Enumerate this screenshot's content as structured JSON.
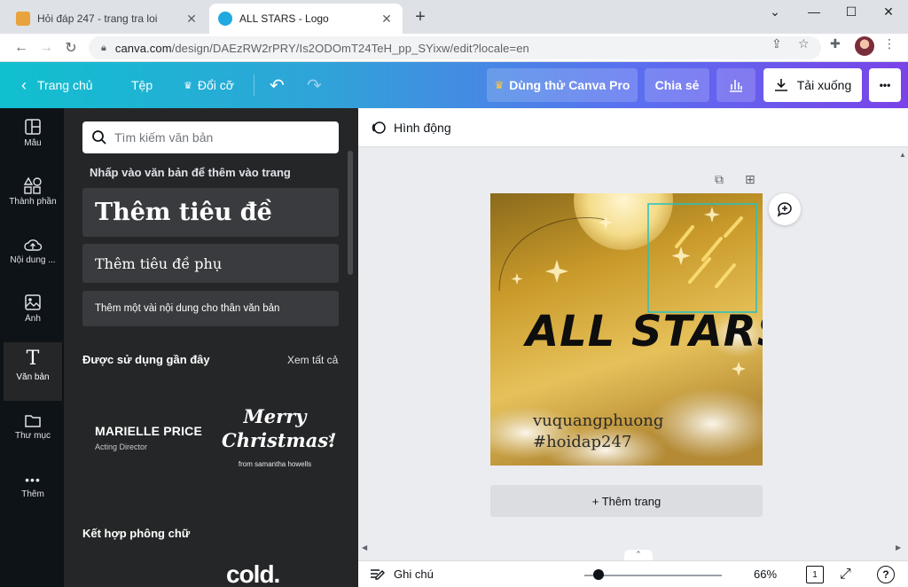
{
  "browser": {
    "tabs": [
      {
        "title": "Hỏi đáp 247 - trang tra loi",
        "favicon_color": "#e8a33c"
      },
      {
        "title": "ALL STARS - Logo",
        "favicon_color": "#1fa9e0"
      }
    ],
    "url_host": "canva.com",
    "url_path": "/design/DAEzRW2rPRY/Is2ODOmT24TeH_pp_SYixw/edit?locale=en",
    "close_glyph": "✕",
    "new_tab_glyph": "+"
  },
  "header": {
    "home_label": "Trang chủ",
    "file_label": "Tệp",
    "resize_label": "Đổi cỡ",
    "try_pro_label": "Dùng thử Canva Pro",
    "share_label": "Chia sẻ",
    "download_label": "Tải xuống",
    "more_glyph": "•••"
  },
  "rail": {
    "items": [
      {
        "label": "Mẫu",
        "icon": "layout-icon"
      },
      {
        "label": "Thành phần",
        "icon": "shapes-icon"
      },
      {
        "label": "Nội dung ...",
        "icon": "cloud-upload-icon"
      },
      {
        "label": "Ảnh",
        "icon": "image-icon"
      },
      {
        "label": "Văn bản",
        "icon": "text-icon"
      },
      {
        "label": "Thư mục",
        "icon": "folder-icon"
      },
      {
        "label": "Thêm",
        "icon": "more-icon"
      }
    ]
  },
  "panel": {
    "search_placeholder": "Tìm kiếm văn bản",
    "hint": "Nhấp vào văn bản để thêm vào trang",
    "heading_label": "Thêm tiêu đề",
    "subheading_label": "Thêm tiêu đề phụ",
    "body_label": "Thêm một vài nội dung cho thân văn bản",
    "recent_title": "Được sử dụng gần đây",
    "see_all": "Xem tất cả",
    "combo1_big": "MARIELLE PRICE",
    "combo1_small": "Acting Director",
    "combo2_line1": "Merry",
    "combo2_line2": "Christmas!",
    "combo2_small": "from samantha howells",
    "font_pairs_title": "Kết hợp phông chữ",
    "bigword": "cold."
  },
  "canvas": {
    "animate_label": "Hình động",
    "design_title": "ALL STARS",
    "design_line1": "vuquangphuong",
    "design_line2": "#hoidap247",
    "add_page_label": "+ Thêm trang",
    "notes_label": "Ghi chú",
    "zoom": "66%",
    "page_count": "1",
    "help_glyph": "?"
  }
}
